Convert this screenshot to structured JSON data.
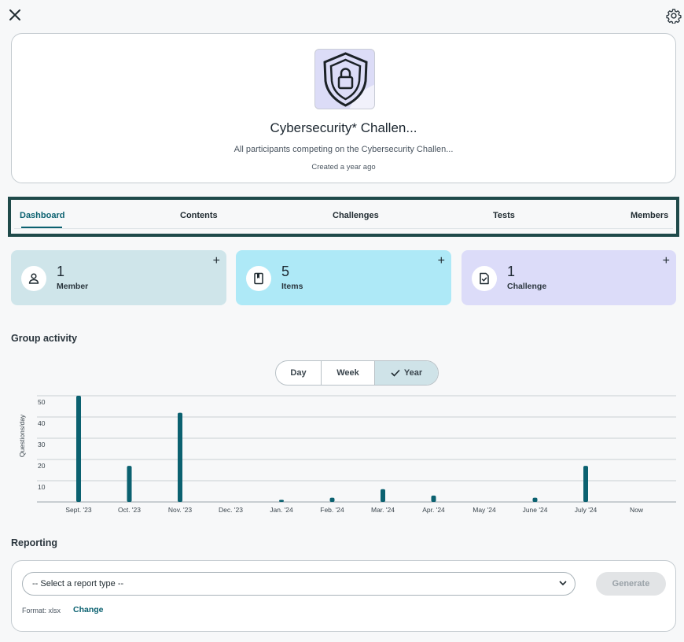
{
  "topbar": {
    "close_icon": "close-icon",
    "settings_icon": "gear-icon"
  },
  "group": {
    "title": "Cybersecurity* Challen...",
    "description": "All participants competing on the Cybersecurity Challen...",
    "created": "Created a year ago",
    "logo_icon": "shield-lock-icon"
  },
  "tabs": [
    {
      "label": "Dashboard",
      "active": true
    },
    {
      "label": "Contents"
    },
    {
      "label": "Challenges"
    },
    {
      "label": "Tests"
    },
    {
      "label": "Members"
    }
  ],
  "stats": [
    {
      "count": "1",
      "label": "Member",
      "icon": "person-icon",
      "color": "#cfe5ea"
    },
    {
      "count": "5",
      "label": "Items",
      "icon": "book-icon",
      "color": "#aee9f7"
    },
    {
      "count": "1",
      "label": "Challenge",
      "icon": "document-check-icon",
      "color": "#dcdcf9"
    }
  ],
  "activity": {
    "title": "Group activity",
    "periods": [
      {
        "label": "Day"
      },
      {
        "label": "Week"
      },
      {
        "label": "Year",
        "selected": true
      }
    ]
  },
  "chart_data": {
    "type": "bar",
    "ylabel": "Questions/day",
    "ylim": [
      0,
      50
    ],
    "yticks": [
      10,
      20,
      30,
      40,
      50
    ],
    "categories": [
      "Sept. '23",
      "Oct. '23",
      "Nov. '23",
      "Dec. '23",
      "Jan. '24",
      "Feb. '24",
      "Mar. '24",
      "Apr. '24",
      "May '24",
      "June '24",
      "July '24",
      "Now"
    ],
    "values": [
      50,
      17,
      42,
      0,
      1,
      2,
      6,
      3,
      0,
      2,
      17,
      0
    ],
    "grid": true,
    "bar_color": "#0b6170"
  },
  "reporting": {
    "title": "Reporting",
    "select_placeholder": "-- Select a report type --",
    "generate_label": "Generate",
    "format_label": "Format: xlsx",
    "change_label": "Change"
  }
}
